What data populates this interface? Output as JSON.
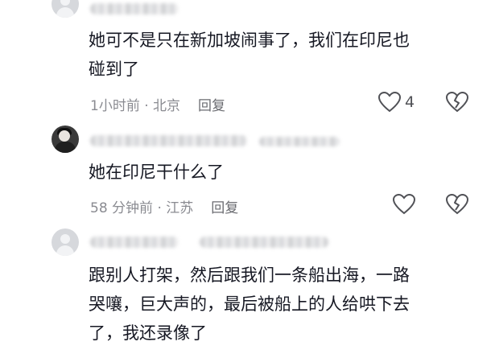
{
  "comments": [
    {
      "content": "她可不是只在新加坡闹事了，我们在印尼也\n碰到了",
      "time_location": "1小时前 · 北京",
      "reply_label": "回复",
      "like_count": "4"
    },
    {
      "content": "她在印尼干什么了",
      "time_location": "58 分钟前 · 江苏",
      "reply_label": "回复",
      "like_count": ""
    },
    {
      "content": "跟别人打架，然后跟我们一条船出海，一路\n哭嚷，巨大声的，最后被船上的人给哄下去\n了，我还录像了"
    }
  ],
  "icons": {
    "like": "heart-outline-icon",
    "dislike": "broken-heart-icon"
  },
  "colors": {
    "text": "#161823",
    "meta": "#8a8b91",
    "icon": "#505156"
  }
}
